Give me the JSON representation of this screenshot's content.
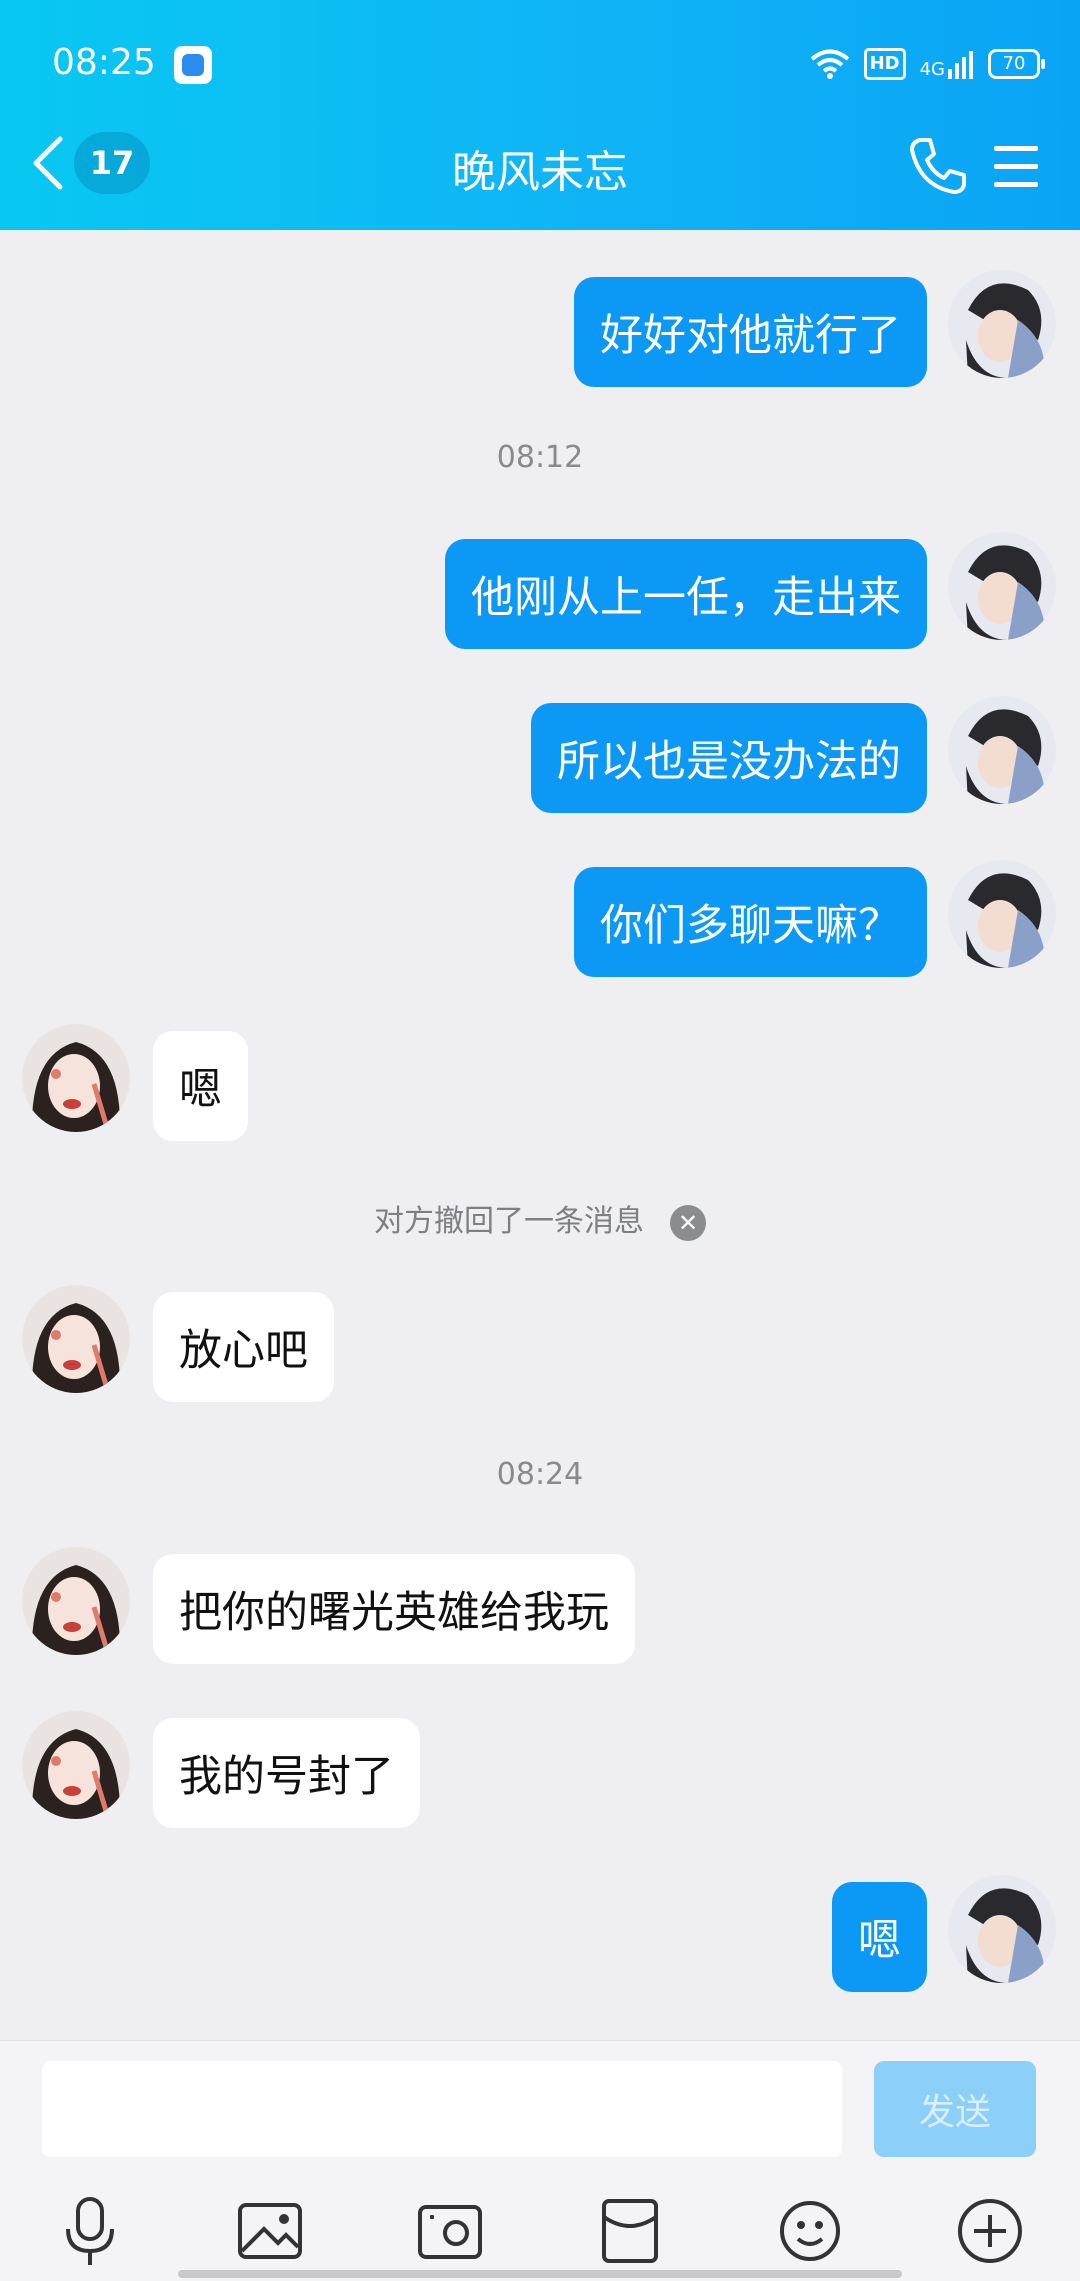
{
  "status_bar": {
    "time": "08:25",
    "hd_label": "HD",
    "network_label": "4G",
    "battery": "70"
  },
  "header": {
    "title": "晚风未忘",
    "unread_count": "17"
  },
  "messages": [
    {
      "side": "out",
      "text": "好好对他就行了"
    },
    {
      "type": "time",
      "text": "08:12"
    },
    {
      "side": "out",
      "text": "他刚从上一任，走出来"
    },
    {
      "side": "out",
      "text": "所以也是没办法的"
    },
    {
      "side": "out",
      "text": "你们多聊天嘛？"
    },
    {
      "side": "in",
      "text": "嗯"
    },
    {
      "type": "recall",
      "text": "对方撤回了一条消息"
    },
    {
      "side": "in",
      "text": "放心吧"
    },
    {
      "type": "time",
      "text": "08:24"
    },
    {
      "side": "in",
      "text": "把你的曙光英雄给我玩"
    },
    {
      "side": "in",
      "text": "我的号封了"
    },
    {
      "side": "out",
      "text": "嗯"
    }
  ],
  "composer": {
    "input_value": "",
    "send_label": "发送"
  },
  "toolbar_icons": [
    "microphone-icon",
    "image-icon",
    "camera-icon",
    "red-packet-icon",
    "emoji-icon",
    "plus-icon"
  ],
  "colors": {
    "header_start": "#08c8f2",
    "header_end": "#0aa4f5",
    "outgoing_bubble": "#0b99f5",
    "incoming_bubble": "#ffffff",
    "send_button": "#8ccff8"
  }
}
